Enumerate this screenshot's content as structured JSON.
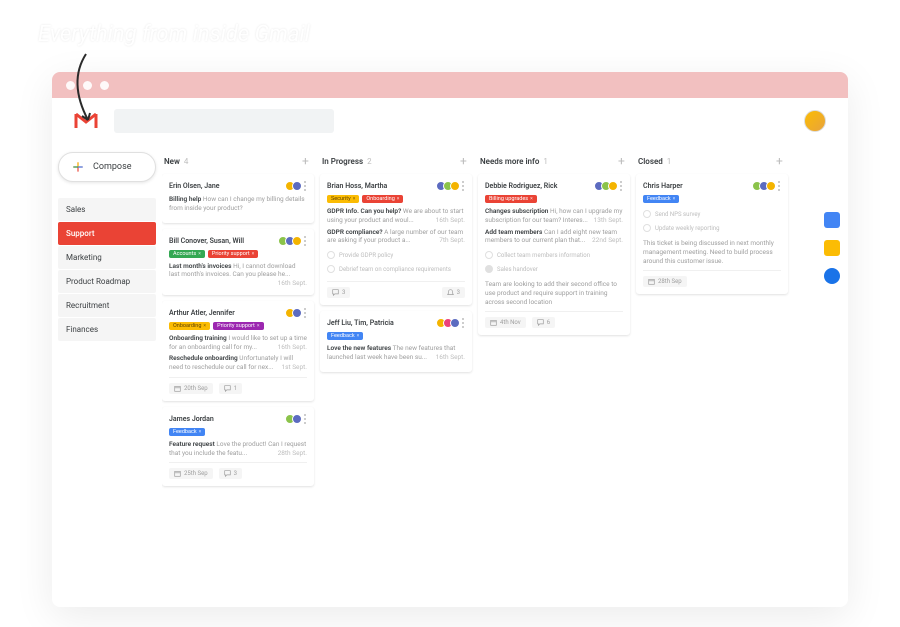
{
  "overlay_title": "Everything from inside Gmail",
  "compose_label": "Compose",
  "sidebar": {
    "items": [
      {
        "label": "Sales",
        "active": false
      },
      {
        "label": "Support",
        "active": true
      },
      {
        "label": "Marketing",
        "active": false
      },
      {
        "label": "Product Roadmap",
        "active": false
      },
      {
        "label": "Recruitment",
        "active": false
      },
      {
        "label": "Finances",
        "active": false
      }
    ]
  },
  "columns": [
    {
      "title": "New",
      "count": 4,
      "cards": [
        {
          "title": "Erin Olsen, Jane",
          "avatars": [
            "av1",
            "av2"
          ],
          "tags": [],
          "lines": [
            {
              "title": "Billing help",
              "body": "How can I change my billing details from inside your product?",
              "date": ""
            }
          ]
        },
        {
          "title": "Bill Conover, Susan, Will",
          "avatars": [
            "av3",
            "av2",
            "av1"
          ],
          "tags": [
            {
              "text": "Accounts",
              "cls": "green"
            },
            {
              "text": "Priority support",
              "cls": "red"
            }
          ],
          "lines": [
            {
              "title": "Last month's invoices",
              "body": "Hi, I cannot download last month's invoices. Can you please he...",
              "date": "16th Sept."
            }
          ]
        },
        {
          "title": "Arthur Atler, Jennifer",
          "avatars": [
            "av1",
            "av2"
          ],
          "tags": [
            {
              "text": "Onboarding",
              "cls": "orange"
            },
            {
              "text": "Priority support",
              "cls": "purple"
            }
          ],
          "lines": [
            {
              "title": "Onboarding training",
              "body": "I would like to set up a time for an onboarding call for my...",
              "date": "16th Sept."
            },
            {
              "title": "Reschedule onboarding",
              "body": "Unfortunately I will need to reschedule our call for nex...",
              "date": "1st Sept."
            }
          ],
          "footer": {
            "date": "20th Sep",
            "comments": "1"
          }
        },
        {
          "title": "James Jordan",
          "avatars": [
            "av3",
            "av2"
          ],
          "tags": [
            {
              "text": "Feedback",
              "cls": "blue"
            }
          ],
          "lines": [
            {
              "title": "Feature request",
              "body": "Love the product! Can I request that you include the featu...",
              "date": "28th Sept."
            }
          ],
          "footer": {
            "date": "25th Sep",
            "comments": "3"
          }
        }
      ]
    },
    {
      "title": "In Progress",
      "count": 2,
      "cards": [
        {
          "title": "Brian Hoss, Martha",
          "avatars": [
            "av2",
            "av3",
            "av1"
          ],
          "tags": [
            {
              "text": "Security",
              "cls": "orange"
            },
            {
              "text": "Onboarding",
              "cls": "red"
            }
          ],
          "lines": [
            {
              "title": "GDPR Info. Can you help?",
              "body": "We are about to start using your product and woul...",
              "date": "16th Sept."
            },
            {
              "title": "GDPR compliance?",
              "body": "A large number of our team are asking if your product a...",
              "date": "7th Sept."
            }
          ],
          "checks": [
            {
              "text": "Provide GDPR policy",
              "done": false
            },
            {
              "text": "Debrief team on compliance requirements",
              "done": false
            }
          ],
          "footer": {
            "comments": "3",
            "bell": "3"
          }
        },
        {
          "title": "Jeff Liu, Tim, Patricia",
          "avatars": [
            "av1",
            "av4",
            "av2"
          ],
          "tags": [
            {
              "text": "Feedback",
              "cls": "blue"
            }
          ],
          "lines": [
            {
              "title": "Love the new features",
              "body": "The new features that launched last week have been su...",
              "date": "16th Sept."
            }
          ]
        }
      ]
    },
    {
      "title": "Needs more info",
      "count": 1,
      "cards": [
        {
          "title": "Debbie Rodriguez, Rick",
          "avatars": [
            "av2",
            "av3",
            "av1"
          ],
          "tags": [
            {
              "text": "Billing upgrades",
              "cls": "red"
            }
          ],
          "lines": [
            {
              "title": "Changes subscription",
              "body": "Hi, how can I upgrade my subscription for our team? Interes...",
              "date": "13th Sept."
            },
            {
              "title": "Add team members",
              "body": "Can I add eight new team members to our current plan that...",
              "date": "22nd Sept."
            }
          ],
          "checks": [
            {
              "text": "Collect team members information",
              "done": false
            },
            {
              "text": "Sales handover",
              "done": true
            }
          ],
          "note": "Team are looking to add their second office to use product and require support in training across second location",
          "footer": {
            "date": "4th Nov",
            "comments": "6"
          }
        }
      ]
    },
    {
      "title": "Closed",
      "count": 1,
      "cards": [
        {
          "title": "Chris Harper",
          "avatars": [
            "av3",
            "av2",
            "av1"
          ],
          "tags": [
            {
              "text": "Feedback",
              "cls": "blue"
            }
          ],
          "lines": [],
          "checks": [
            {
              "text": "Send NPS survey",
              "done": false
            },
            {
              "text": "Update weekly reporting",
              "done": false
            }
          ],
          "note": "This ticket is being discussed in next monthly management meeting. Need to build process around this customer issue.",
          "footer": {
            "date": "28th Sep"
          }
        }
      ]
    }
  ]
}
